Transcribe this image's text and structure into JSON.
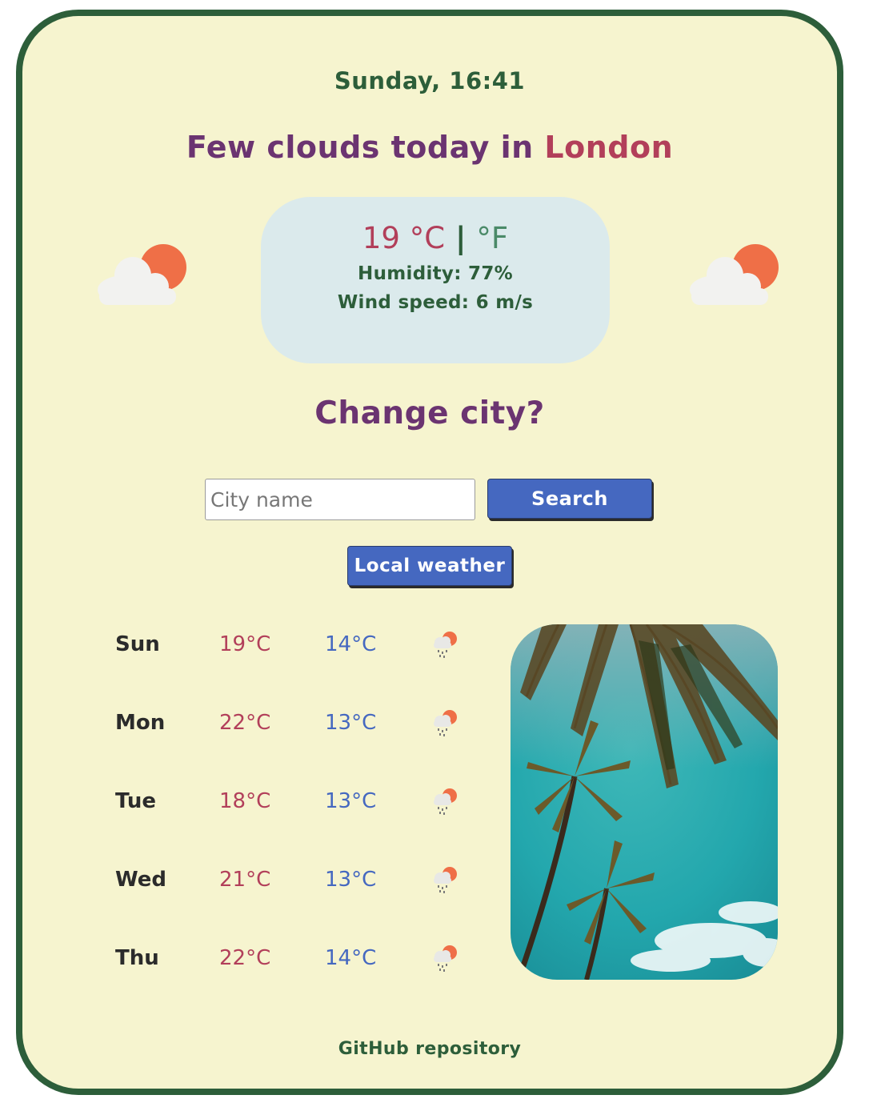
{
  "header": {
    "datetime": "Sunday, 16:41",
    "headline_prefix": "Few clouds today in ",
    "city": "London"
  },
  "current": {
    "temperature": "19",
    "unit_c": " °C",
    "separator": " | ",
    "unit_f": "°F",
    "humidity_label": "Humidity: ",
    "humidity_value": "77%",
    "wind_label": "Wind speed: ",
    "wind_value": "6 m/s",
    "icon": "few-clouds-icon"
  },
  "search": {
    "heading": "Change city?",
    "placeholder": "City name",
    "value": "",
    "search_label": "Search",
    "local_label": "Local weather"
  },
  "forecast": [
    {
      "day": "Sun",
      "max": "19°C",
      "min": "14°C",
      "icon": "rain-cloud-sun-icon"
    },
    {
      "day": "Mon",
      "max": "22°C",
      "min": "13°C",
      "icon": "rain-cloud-sun-icon"
    },
    {
      "day": "Tue",
      "max": "18°C",
      "min": "13°C",
      "icon": "rain-cloud-sun-icon"
    },
    {
      "day": "Wed",
      "max": "21°C",
      "min": "13°C",
      "icon": "rain-cloud-sun-icon"
    },
    {
      "day": "Thu",
      "max": "22°C",
      "min": "14°C",
      "icon": "rain-cloud-sun-icon"
    }
  ],
  "photo": {
    "subject": "palm-trees-photo"
  },
  "footer": {
    "link_label": "GitHub repository"
  },
  "colors": {
    "card_background": "#f6f4cf",
    "card_border": "#2d5e3a",
    "headline": "#6b3471",
    "city_accent": "#b23f5a",
    "button": "#4568c0",
    "current_box": "#dbeaec"
  }
}
